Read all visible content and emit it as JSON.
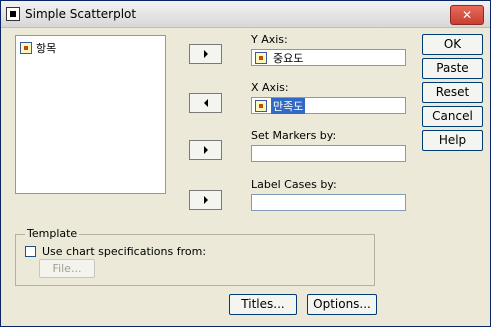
{
  "window": {
    "title": "Simple Scatterplot",
    "close_label": "✕"
  },
  "source_list": {
    "items": [
      {
        "label": "항목"
      }
    ]
  },
  "fields": {
    "y_axis": {
      "label": "Y Axis:",
      "value": "중요도"
    },
    "x_axis": {
      "label": "X Axis:",
      "value": "만족도"
    },
    "set_markers": {
      "label": "Set Markers by:",
      "value": ""
    },
    "label_cases": {
      "label": "Label Cases by:",
      "value": ""
    }
  },
  "buttons": {
    "ok": "OK",
    "paste": "Paste",
    "reset": "Reset",
    "cancel": "Cancel",
    "help": "Help",
    "titles": "Titles...",
    "options": "Options..."
  },
  "template": {
    "legend": "Template",
    "checkbox_label": "Use chart specifications from:",
    "checked": false,
    "file_button": "File..."
  }
}
